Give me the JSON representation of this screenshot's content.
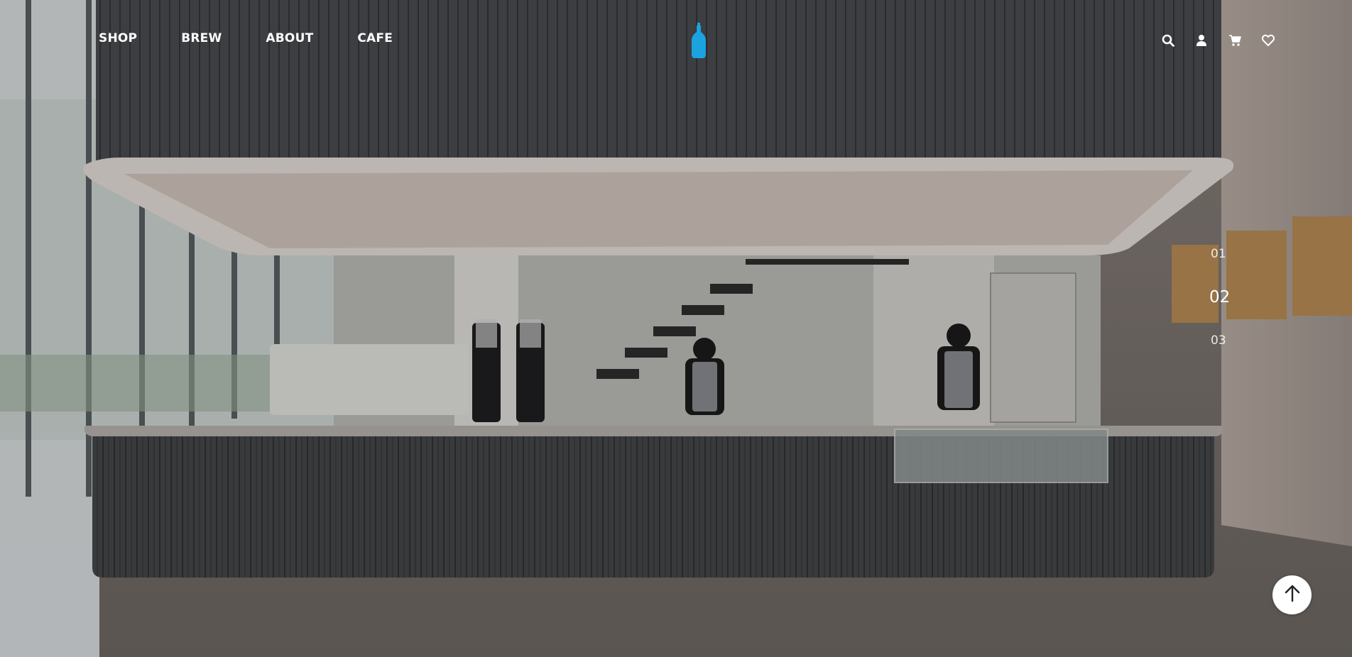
{
  "nav": {
    "items": [
      {
        "label": "SHOP"
      },
      {
        "label": "BREW"
      },
      {
        "label": "ABOUT"
      },
      {
        "label": "CAFE"
      }
    ]
  },
  "brand": {
    "logo_icon": "blue-bottle-icon",
    "color": "#1aa3df"
  },
  "header_icons": [
    "search-icon",
    "user-icon",
    "cart-icon",
    "heart-icon"
  ],
  "hero": {
    "description": "cafe interior photo"
  },
  "pager": {
    "slides": [
      "01",
      "02",
      "03"
    ],
    "active": "02"
  },
  "scroll_top": {
    "icon": "arrow-up-icon"
  }
}
